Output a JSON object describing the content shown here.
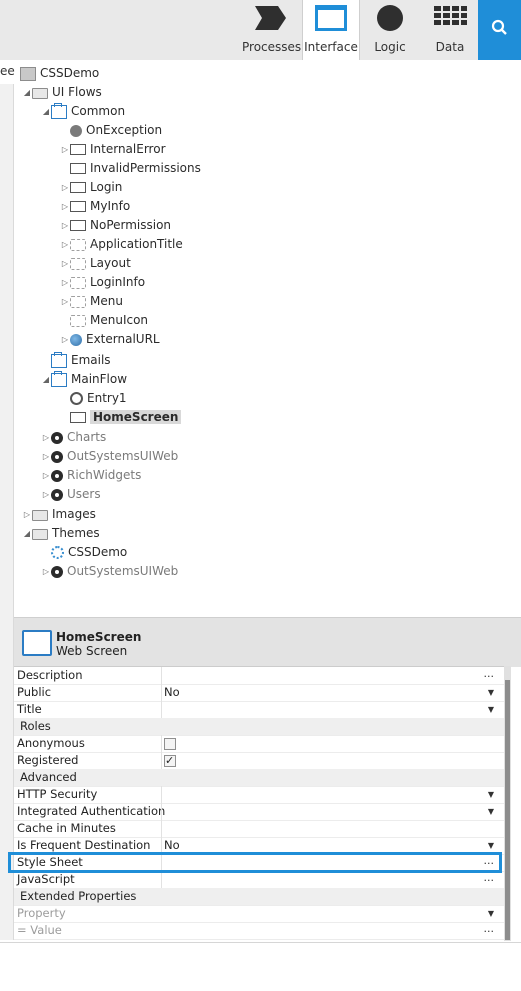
{
  "toolbar": {
    "tabs": [
      {
        "label": "Processes",
        "icon": "processes-icon"
      },
      {
        "label": "Interface",
        "icon": "interface-icon",
        "active": true
      },
      {
        "label": "Logic",
        "icon": "logic-icon"
      },
      {
        "label": "Data",
        "icon": "data-icon"
      }
    ],
    "search_icon": "search-icon"
  },
  "left_strip_text": "ee",
  "tree": {
    "root": "CSSDemo",
    "ui_flows": "UI Flows",
    "common": "Common",
    "common_items": [
      "OnException",
      "InternalError",
      "InvalidPermissions",
      "Login",
      "MyInfo",
      "NoPermission",
      "ApplicationTitle",
      "Layout",
      "LoginInfo",
      "Menu",
      "MenuIcon",
      "ExternalURL"
    ],
    "emails": "Emails",
    "mainflow": "MainFlow",
    "entry1": "Entry1",
    "homescreen": "HomeScreen",
    "modules": [
      "Charts",
      "OutSystemsUIWeb",
      "RichWidgets",
      "Users"
    ],
    "images": "Images",
    "themes": "Themes",
    "themes_items": [
      "CSSDemo",
      "OutSystemsUIWeb"
    ]
  },
  "header": {
    "title": "HomeScreen",
    "subtitle": "Web Screen"
  },
  "properties": {
    "description": "Description",
    "public": "Public",
    "public_value": "No",
    "title": "Title",
    "roles_section": "Roles",
    "anonymous": "Anonymous",
    "registered": "Registered",
    "advanced_section": "Advanced",
    "http_security": "HTTP Security",
    "integrated_auth": "Integrated Authentication",
    "cache_minutes": "Cache in Minutes",
    "frequent_dest": "Is Frequent Destination",
    "frequent_dest_value": "No",
    "style_sheet": "Style Sheet",
    "javascript": "JavaScript",
    "extended_section": "Extended Properties",
    "property_placeholder": "Property",
    "value_placeholder": "= Value",
    "dots": "...",
    "dropdown_glyph": "▼"
  },
  "colors": {
    "accent": "#1f8ed8",
    "toolbar_bg": "#e9e9e9"
  }
}
